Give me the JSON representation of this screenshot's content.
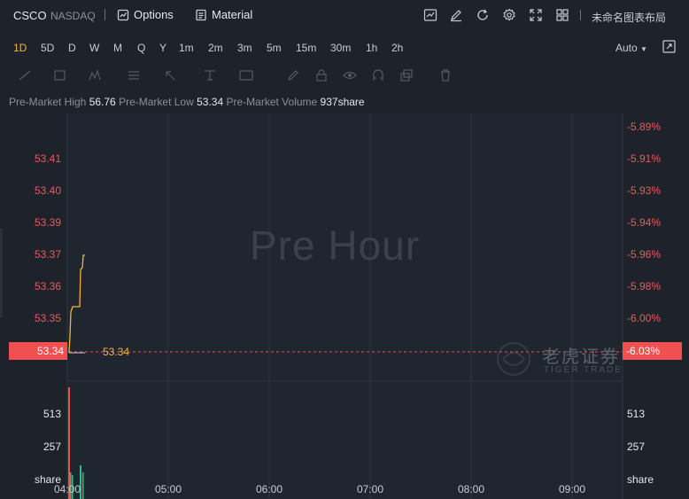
{
  "header": {
    "ticker": "CSCO",
    "exchange": "NASDAQ",
    "options_label": "Options",
    "material_label": "Material",
    "layout_name": "未命名图表布局"
  },
  "periods": {
    "items": [
      "1D",
      "5D",
      "D",
      "W",
      "M",
      "Q",
      "Y",
      "1m",
      "2m",
      "3m",
      "5m",
      "15m",
      "30m",
      "1h",
      "2h"
    ],
    "active": "1D",
    "scale_mode": "Auto"
  },
  "info": {
    "high_label": "Pre-Market High",
    "high_value": "56.76",
    "low_label": "Pre-Market Low",
    "low_value": "53.34",
    "volume_label": "Pre-Market Volume",
    "volume_value": "937share"
  },
  "chart_data": {
    "type": "line",
    "watermark_title": "Pre Hour",
    "brand_cn": "老虎证券",
    "brand_en": "TIGER TRADE",
    "price_axis_left": [
      "53.41",
      "53.40",
      "53.39",
      "53.37",
      "53.36",
      "53.35"
    ],
    "price_axis_right": [
      "-5.89%",
      "-5.91%",
      "-5.93%",
      "-5.94%",
      "-5.96%",
      "-5.98%",
      "-6.00%"
    ],
    "last_price": "53.34",
    "last_change": "-6.03%",
    "volume_axis": [
      "513",
      "257",
      "share"
    ],
    "time_axis": [
      "04:00",
      "05:00",
      "06:00",
      "07:00",
      "08:00",
      "09:00"
    ],
    "colors": {
      "line": "#f5b335",
      "up": "#f0504f",
      "down": "#2ebd85",
      "last_price": "#f0504f"
    }
  }
}
